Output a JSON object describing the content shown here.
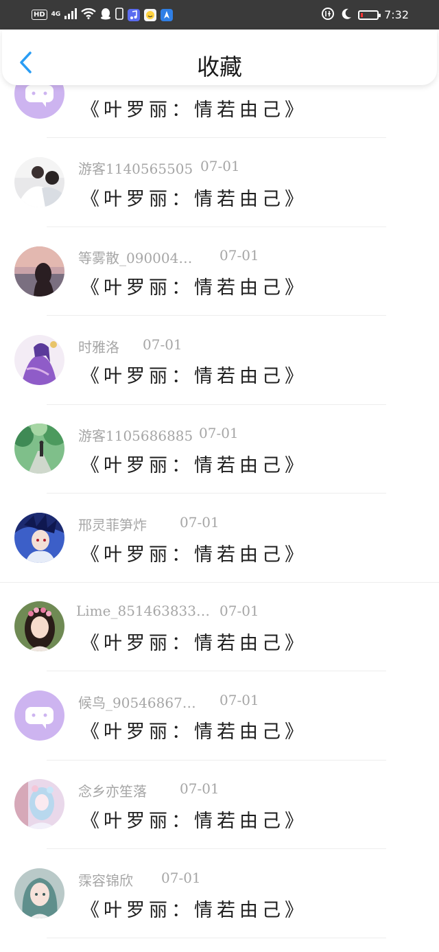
{
  "status_bar": {
    "hd": "HD",
    "network": "4G",
    "time": "7:32"
  },
  "header": {
    "title": "收藏"
  },
  "posts": [
    {
      "user": "",
      "date": "",
      "quote": "《叶罗丽：情若由己》",
      "avatar": "default-chat-avatar"
    },
    {
      "user": "游客1140565505",
      "date": "07-01",
      "quote": "《叶罗丽：情若由己》",
      "avatar": "couple-photo-avatar"
    },
    {
      "user": "等雾散_090004…",
      "date": "07-01",
      "quote": "《叶罗丽：情若由己》",
      "avatar": "sunset-girl-avatar"
    },
    {
      "user": "时雅洛",
      "date": "07-01",
      "quote": "《叶罗丽：情若由己》",
      "avatar": "anime-purple-girl-avatar"
    },
    {
      "user": "游客1105686885",
      "date": "07-01",
      "quote": "《叶罗丽：情若由己》",
      "avatar": "forest-path-avatar"
    },
    {
      "user": "邢灵菲笋炸",
      "date": "07-01",
      "quote": "《叶罗丽：情若由己》",
      "avatar": "anime-blue-ninja-avatar"
    },
    {
      "user": "Lime_851463833…",
      "date": "07-01",
      "quote": "《叶罗丽：情若由己》",
      "avatar": "woman-flower-crown-avatar"
    },
    {
      "user": "候鸟_90546867…",
      "date": "07-01",
      "quote": "《叶罗丽：情若由己》",
      "avatar": "default-chat-avatar"
    },
    {
      "user": "念乡亦笙落",
      "date": "07-01",
      "quote": "《叶罗丽：情若由己》",
      "avatar": "anime-pastel-girl-avatar"
    },
    {
      "user": "霂容锦欣",
      "date": "07-01",
      "quote": "《叶罗丽：情若由己》",
      "avatar": "anime-teal-hair-avatar"
    }
  ],
  "colors": {
    "status_bar": "#3a3a3a",
    "accent_blue": "#2a9df4",
    "meta_gray": "#a6a6a6",
    "default_avatar": "#cdb4f0"
  }
}
